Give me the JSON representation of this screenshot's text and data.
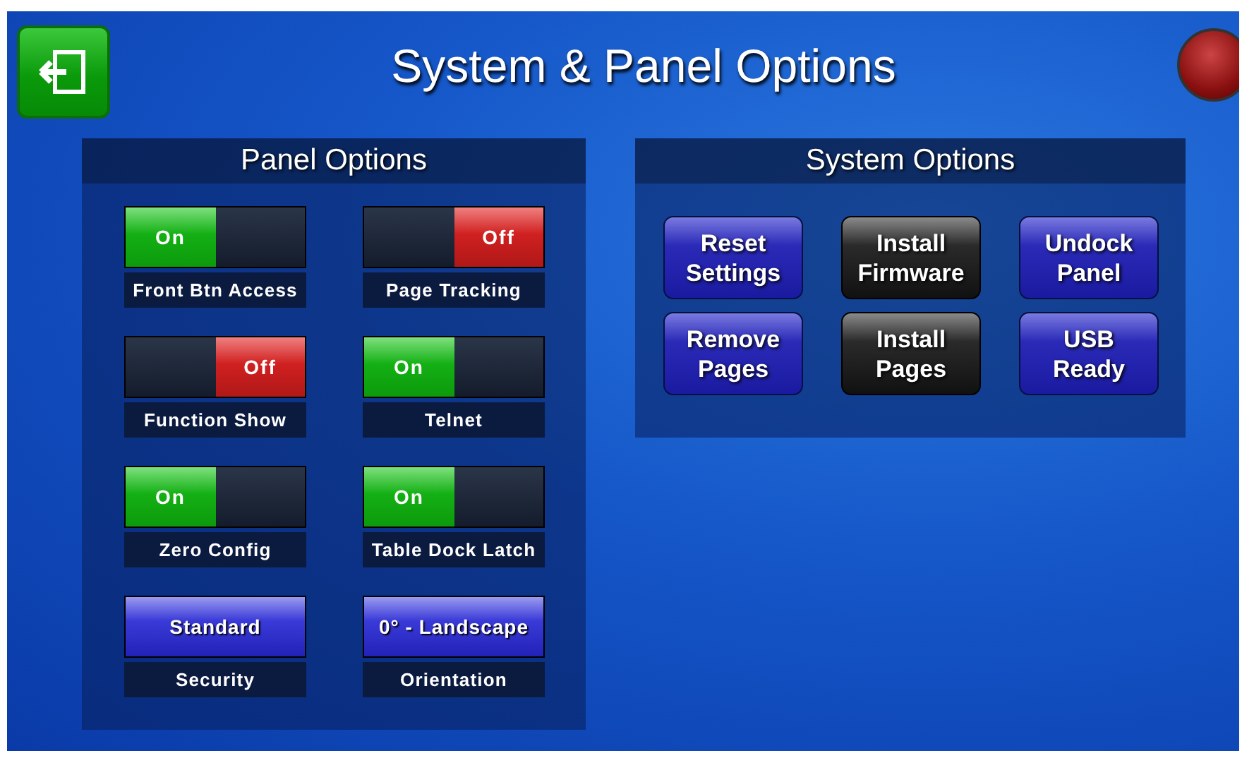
{
  "title": "System & Panel Options",
  "panel_options": {
    "title": "Panel Options",
    "items": [
      {
        "kind": "toggle",
        "label": "Front Btn Access",
        "on": true,
        "value": "On"
      },
      {
        "kind": "toggle",
        "label": "Page Tracking",
        "on": false,
        "value": "Off"
      },
      {
        "kind": "toggle",
        "label": "Function Show",
        "on": false,
        "value": "Off"
      },
      {
        "kind": "toggle",
        "label": "Telnet",
        "on": true,
        "value": "On"
      },
      {
        "kind": "toggle",
        "label": "Zero Config",
        "on": true,
        "value": "On"
      },
      {
        "kind": "toggle",
        "label": "Table Dock Latch",
        "on": true,
        "value": "On"
      },
      {
        "kind": "select",
        "label": "Security",
        "value": "Standard"
      },
      {
        "kind": "select",
        "label": "Orientation",
        "value": "0° - Landscape"
      }
    ]
  },
  "system_options": {
    "title": "System Options",
    "buttons": [
      {
        "label": "Reset Settings",
        "disabled": false
      },
      {
        "label": "Install Firmware",
        "disabled": true
      },
      {
        "label": "Undock Panel",
        "disabled": false
      },
      {
        "label": "Remove Pages",
        "disabled": false
      },
      {
        "label": "Install Pages",
        "disabled": true
      },
      {
        "label": "USB Ready",
        "disabled": false
      }
    ]
  }
}
